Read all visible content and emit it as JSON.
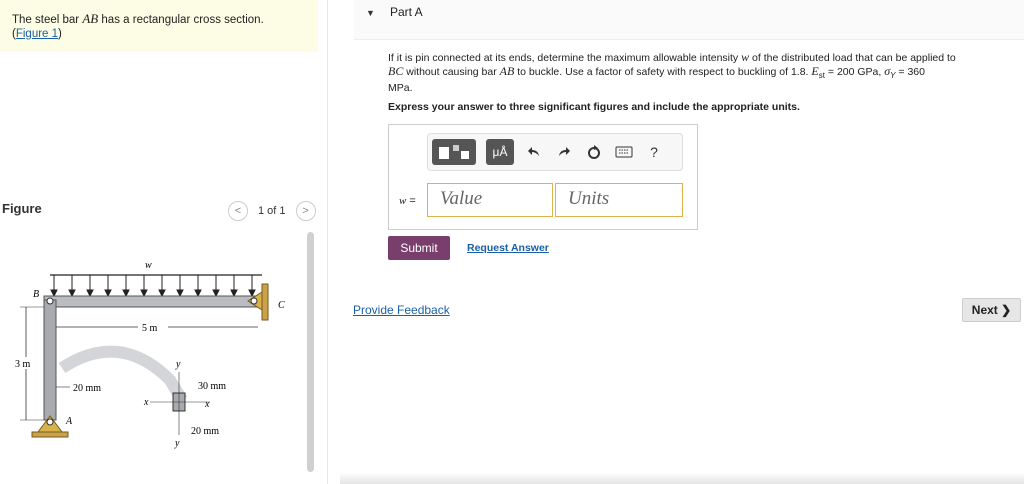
{
  "intro": {
    "text_before": "The steel bar ",
    "bar_name": "AB",
    "text_after": " has a rectangular cross section.",
    "figure_link": "Figure 1",
    "paren_open": "(",
    "paren_close": ")"
  },
  "figure_panel": {
    "label": "Figure",
    "pager_text": "1 of 1",
    "prev_symbol": "<",
    "next_symbol": ">",
    "labels": {
      "w": "w",
      "B": "B",
      "C": "C",
      "A": "A",
      "span": "5 m",
      "height": "3 m",
      "depth_side": "20 mm",
      "section_height": "30 mm",
      "section_width": "20 mm",
      "x": "x",
      "y": "y"
    }
  },
  "part": {
    "caret": "▼",
    "title": "Part A"
  },
  "question": {
    "t1": "If it is pin connected at its ends, determine the maximum allowable intensity ",
    "w": "w",
    "t2": " of the distributed load that can be applied to",
    "bc": "BC",
    "t3": " without causing bar ",
    "ab": "AB",
    "t4": " to buckle. Use a factor of safety with respect to buckling of 1.8. ",
    "est": "E",
    "est_sub": "st",
    "t5": " = 200 GPa, ",
    "sigma": "σ",
    "sigma_sub": "Y",
    "t6": " = 360",
    "t7": "MPa."
  },
  "instruction": "Express your answer to three significant figures and include the appropriate units.",
  "answer": {
    "var_label": "w",
    "equals": " =",
    "value_placeholder": "Value",
    "units_placeholder": "Units",
    "toolbar": {
      "units_symbol": "μÅ",
      "help_symbol": "?"
    }
  },
  "actions": {
    "submit": "Submit",
    "request_answer": "Request Answer",
    "provide_feedback": "Provide Feedback",
    "next": "Next ❯"
  },
  "colors": {
    "submit_bg": "#7a3e6c",
    "link": "#1a5fa8",
    "intro_bg": "#fdfde6",
    "input_border": "#e0b24a"
  }
}
